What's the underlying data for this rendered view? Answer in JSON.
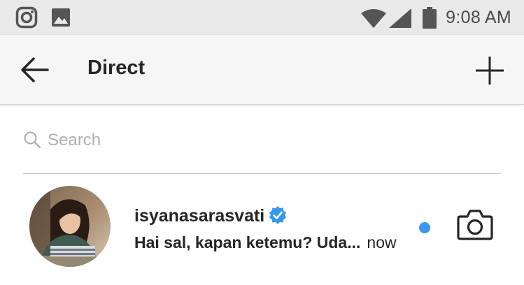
{
  "status_bar": {
    "time": "9:08 AM",
    "icons": [
      "instagram-notification-icon",
      "image-notification-icon",
      "wifi-icon",
      "signal-icon",
      "battery-icon"
    ]
  },
  "header": {
    "title": "Direct",
    "back_icon": "arrow-left-icon",
    "new_icon": "plus-icon"
  },
  "search": {
    "placeholder": "Search",
    "value": ""
  },
  "threads": [
    {
      "username": "isyanasarasvati",
      "verified": true,
      "preview": "Hai sal, kapan ketemu? Uda...",
      "time": "now",
      "unread": true,
      "action_icon": "camera-icon"
    }
  ],
  "colors": {
    "status_bar_bg": "#e9e9e9",
    "app_bar_bg": "#f6f6f6",
    "text": "#262626",
    "accent_blue": "#3897f0",
    "placeholder": "#b0b0b0"
  }
}
